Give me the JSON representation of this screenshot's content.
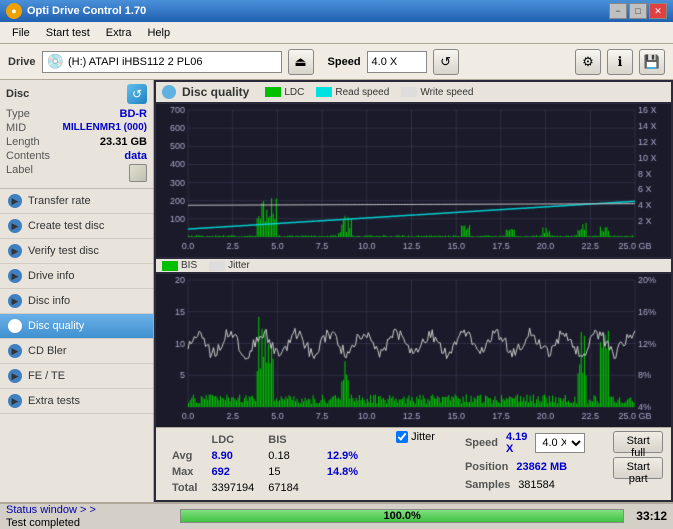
{
  "app": {
    "title": "Opti Drive Control 1.70",
    "icon": "●"
  },
  "titlebar": {
    "minimize": "−",
    "maximize": "□",
    "close": "✕"
  },
  "menu": {
    "items": [
      "File",
      "Start test",
      "Extra",
      "Help"
    ]
  },
  "toolbar": {
    "drive_label": "Drive",
    "drive_icon": "💿",
    "drive_value": "(H:)  ATAPI iHBS112  2 PL06",
    "speed_label": "Speed",
    "speed_value": "4.0 X"
  },
  "disc": {
    "title": "Disc",
    "type_label": "Type",
    "type_value": "BD-R",
    "mid_label": "MID",
    "mid_value": "MILLENMR1 (000)",
    "length_label": "Length",
    "length_value": "23.31 GB",
    "contents_label": "Contents",
    "contents_value": "data",
    "label_label": "Label"
  },
  "nav": {
    "items": [
      {
        "id": "transfer-rate",
        "label": "Transfer rate",
        "active": false
      },
      {
        "id": "create-test-disc",
        "label": "Create test disc",
        "active": false
      },
      {
        "id": "verify-test-disc",
        "label": "Verify test disc",
        "active": false
      },
      {
        "id": "drive-info",
        "label": "Drive info",
        "active": false
      },
      {
        "id": "disc-info",
        "label": "Disc info",
        "active": false
      },
      {
        "id": "disc-quality",
        "label": "Disc quality",
        "active": true
      },
      {
        "id": "cd-bler",
        "label": "CD Bler",
        "active": false
      },
      {
        "id": "fe-te",
        "label": "FE / TE",
        "active": false
      },
      {
        "id": "extra-tests",
        "label": "Extra tests",
        "active": false
      }
    ]
  },
  "chart": {
    "title": "Disc quality",
    "legend": {
      "ldc_label": "LDC",
      "ldc_color": "#00c000",
      "read_speed_label": "Read speed",
      "read_speed_color": "#00e0e0",
      "write_speed_label": "Write speed",
      "write_speed_color": "#ffffff",
      "bis_label": "BIS",
      "bis_color": "#00c000",
      "jitter_label": "Jitter",
      "jitter_color": "#ffffff"
    },
    "top": {
      "y_max": 700,
      "y_labels": [
        "700",
        "600",
        "500",
        "400",
        "300",
        "200",
        "100"
      ],
      "x_labels": [
        "0.0",
        "2.5",
        "5.0",
        "7.5",
        "10.0",
        "12.5",
        "15.0",
        "17.5",
        "20.0",
        "22.5",
        "25.0 GB"
      ],
      "right_labels": [
        "16 X",
        "14 X",
        "12 X",
        "10 X",
        "8 X",
        "6 X",
        "4 X",
        "2 X"
      ]
    },
    "bottom": {
      "y_max": 20,
      "y_labels": [
        "20",
        "15",
        "10",
        "5"
      ],
      "right_labels": [
        "20%",
        "16%",
        "12%",
        "8%",
        "4%"
      ]
    }
  },
  "stats": {
    "avg_label": "Avg",
    "max_label": "Max",
    "total_label": "Total",
    "ldc_avg": "8.90",
    "ldc_max": "692",
    "ldc_total": "3397194",
    "bis_avg": "0.18",
    "bis_max": "15",
    "bis_total": "67184",
    "jitter_label": "Jitter",
    "jitter_avg": "12.9%",
    "jitter_max": "14.8%",
    "speed_label": "Speed",
    "speed_value": "4.19 X",
    "speed_select": "4.0 X",
    "position_label": "Position",
    "position_value": "23862 MB",
    "samples_label": "Samples",
    "samples_value": "381584",
    "start_full": "Start full",
    "start_part": "Start part"
  },
  "statusbar": {
    "status_window": "Status window > >",
    "test_completed": "Test completed",
    "fe_te": "FE / TE",
    "drive_info": "Drive info",
    "progress": "100.0%",
    "progress_value": 100,
    "time": "33:12"
  }
}
